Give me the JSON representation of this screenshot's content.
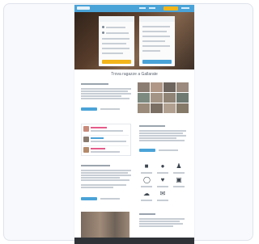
{
  "hero": {
    "left_form_color": "#f3b51a",
    "right_form_color": "#4aa3d8"
  },
  "sections": {
    "gallery_title": "Trova ragazze a Gallarate"
  },
  "colors": {
    "nav": "#4aa3d8",
    "accent_yellow": "#f3b51a",
    "accent_blue": "#4aa3d8",
    "footer": "#2f3338"
  },
  "icons": [
    "lock-icon",
    "chat-icon",
    "people-icon",
    "user-icon",
    "heart-icon",
    "camera-icon",
    "cloud-icon",
    "message-icon"
  ]
}
